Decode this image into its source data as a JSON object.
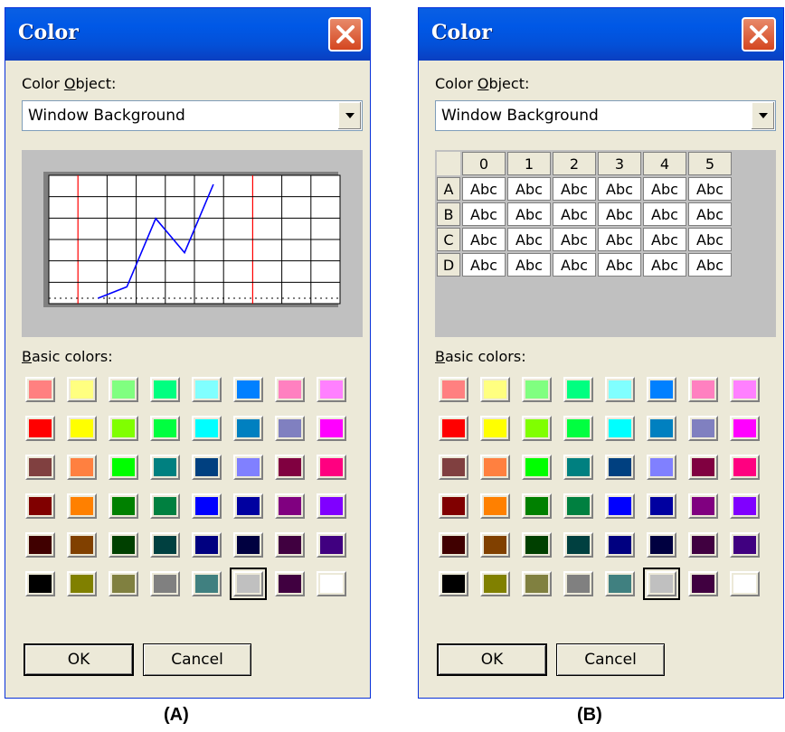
{
  "dialogs": [
    {
      "id": "A",
      "title": "Color",
      "color_object_label_prefix": "Color ",
      "color_object_label_u": "O",
      "color_object_label_suffix": "bject:",
      "color_object_value": "Window Background",
      "basic_colors_label_u": "B",
      "basic_colors_label_suffix": "asic colors:",
      "ok_label": "OK",
      "cancel_label": "Cancel",
      "caption": "(A)",
      "preview": "line-chart",
      "selected_swatch": "5-5"
    },
    {
      "id": "B",
      "title": "Color",
      "color_object_label_prefix": "Color ",
      "color_object_label_u": "O",
      "color_object_label_suffix": "bject:",
      "color_object_value": "Window Background",
      "basic_colors_label_u": "B",
      "basic_colors_label_suffix": "asic colors:",
      "ok_label": "OK",
      "cancel_label": "Cancel",
      "caption": "(B)",
      "preview": "grid",
      "selected_swatch": "5-5"
    }
  ],
  "basic_colors": [
    [
      "#ff8080",
      "#ffff80",
      "#80ff80",
      "#00ff80",
      "#80ffff",
      "#0080ff",
      "#ff80c0",
      "#ff80ff"
    ],
    [
      "#ff0000",
      "#ffff00",
      "#80ff00",
      "#00ff40",
      "#00ffff",
      "#0080c0",
      "#8080c0",
      "#ff00ff"
    ],
    [
      "#804040",
      "#ff8040",
      "#00ff00",
      "#008080",
      "#004080",
      "#8080ff",
      "#800040",
      "#ff0080"
    ],
    [
      "#800000",
      "#ff8000",
      "#008000",
      "#008040",
      "#0000ff",
      "#0000a0",
      "#800080",
      "#8000ff"
    ],
    [
      "#400000",
      "#804000",
      "#004000",
      "#004040",
      "#000080",
      "#000040",
      "#400040",
      "#400080"
    ],
    [
      "#000000",
      "#808000",
      "#808040",
      "#808080",
      "#408080",
      "#c0c0c0",
      "#400040",
      "#ffffff"
    ]
  ],
  "grid_preview": {
    "col_headers": [
      "0",
      "1",
      "2",
      "3",
      "4",
      "5"
    ],
    "row_headers": [
      "A",
      "B",
      "C",
      "D"
    ],
    "cell_text": "Abc"
  },
  "chart_data": {
    "type": "line",
    "series": [
      {
        "values": [
          0,
          0.5,
          3.5,
          2,
          5
        ]
      }
    ],
    "x": [
      1,
      2,
      3,
      4,
      5
    ],
    "grid": true,
    "reference_lines_color": "#ff0000",
    "series_color": "#0000ff"
  }
}
